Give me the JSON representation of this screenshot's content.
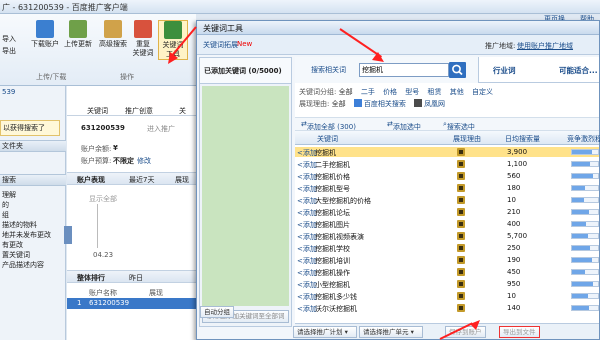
{
  "bg": {
    "title": "广 - 631200539 - 百度推广客户端",
    "ribbon": {
      "import": "导入",
      "export": "导出",
      "download_account": "下载账户",
      "upload_update": "上传更新",
      "advanced_search": "高级搜索",
      "rename_keywords": "重复\n关键词",
      "keyword_tool": "关键词\n工具",
      "group_upload": "上传/下载",
      "group_ops": "操作"
    },
    "left": {
      "account": "539",
      "warn": "以获得搜索了",
      "folder": "文件夹",
      "search_label": "搜索",
      "items": [
        "理解",
        "的",
        "组",
        "描述的物料",
        "地并未发布更改",
        "有更改",
        "置关键词",
        "产品描述内容"
      ]
    },
    "main": {
      "tab1": "关键词",
      "tab2": "推广创意",
      "tab3": "关",
      "account_id": "631200539",
      "login": "进入推广",
      "balance_label": "账户余额:",
      "balance_val": "¥",
      "budget_label": "账户预算:",
      "budget_val": "不限定",
      "budget_edit": "修改",
      "perf": "账户表现",
      "recent": "最近7天",
      "show": "展现",
      "show_all": "显示全部",
      "axis_date": "04.23",
      "ranking": "整体排行",
      "yesterday": "昨日",
      "account_name": "账户名称",
      "impr": "展现",
      "row_num": "1",
      "row_acc": "631200539"
    },
    "right": {
      "top1": "更页换",
      "top2": "帮助"
    }
  },
  "dialog": {
    "title": "关键词工具",
    "sub_link": "关键词拓展",
    "sub_new": "New",
    "promo_area_label": "推广地域:",
    "promo_area_value": "使用账户推广地域",
    "added_label": "已添加关键词 (0/5000)",
    "search_tab_label": "搜索相关词",
    "search_value": "挖掘机",
    "industry_tab": "行业词",
    "explore_tab": "可能适合...",
    "filter_row1": {
      "label": "关键词分组:",
      "all": "全部",
      "opts": [
        "二手",
        "价格",
        "型号",
        "租赁",
        "其他",
        "自定义"
      ]
    },
    "filter_row2": {
      "label": "展现理由:",
      "all": "全部",
      "opts": [
        "百度相关搜索",
        "凤凰网"
      ]
    },
    "actions": {
      "add_all": "添加全部 (300)",
      "add_selected": "添加选中",
      "search_selected": "搜索选中"
    },
    "columns": {
      "kw": "关键词",
      "reason": "展现理由",
      "volume": "日均搜索量",
      "competition": "竞争激烈程度"
    },
    "add_link": "<添加",
    "rows": [
      {
        "kw": "挖掘机",
        "vol": "3,900",
        "comp": 0.75
      },
      {
        "kw": "二手挖掘机",
        "vol": "1,100",
        "comp": 0.7
      },
      {
        "kw": "挖掘机价格",
        "vol": "560",
        "comp": 0.8
      },
      {
        "kw": "挖掘机型号",
        "vol": "180",
        "comp": 0.5
      },
      {
        "kw": "大型挖掘机的价格",
        "vol": "10",
        "comp": 0.45
      },
      {
        "kw": "挖掘机论坛",
        "vol": "210",
        "comp": 0.65
      },
      {
        "kw": "挖掘机图片",
        "vol": "400",
        "comp": 0.55
      },
      {
        "kw": "挖掘机视频表演",
        "vol": "5,700",
        "comp": 0.6
      },
      {
        "kw": "挖掘机学校",
        "vol": "250",
        "comp": 0.7
      },
      {
        "kw": "挖掘机培训",
        "vol": "190",
        "comp": 0.75
      },
      {
        "kw": "挖掘机操作",
        "vol": "450",
        "comp": 0.5
      },
      {
        "kw": "小型挖掘机",
        "vol": "950",
        "comp": 0.8
      },
      {
        "kw": "挖掘机多少钱",
        "vol": "10",
        "comp": 0.6
      },
      {
        "kw": "沃尔沃挖掘机",
        "vol": "140",
        "comp": 0.65
      }
    ],
    "remove_all": "移除已添加关键词至全部词",
    "auto_group": "自动分组",
    "plan_select": "请选择推广计划",
    "unit_select": "请选择推广单元",
    "save_account": "保存到账户",
    "export_file": "导出到文件"
  },
  "colors": {
    "accent": "#2f6fc0",
    "selected_row": "#ffe28a",
    "annotation_arrow": "#ff2020",
    "left_green": "#c9e4bf"
  }
}
